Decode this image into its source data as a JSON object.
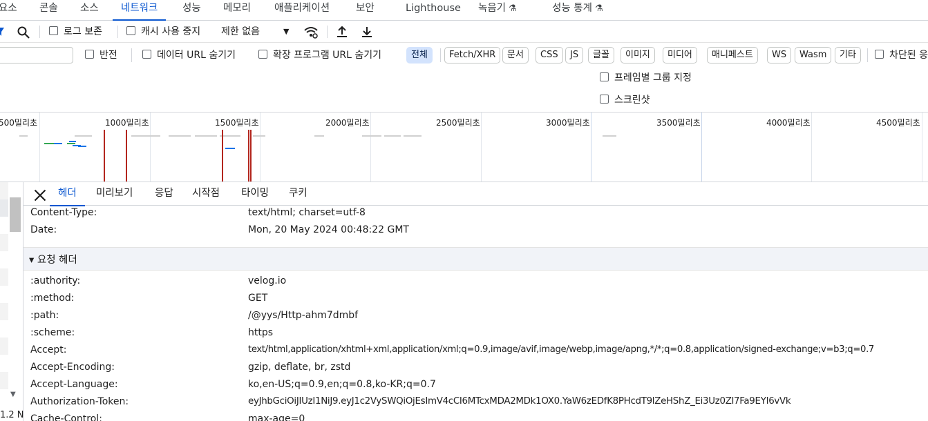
{
  "panel_tabs": [
    {
      "label": "요소"
    },
    {
      "label": "콘솔"
    },
    {
      "label": "소스"
    },
    {
      "label": "네트워크"
    },
    {
      "label": "성능"
    },
    {
      "label": "메모리"
    },
    {
      "label": "애플리케이션"
    },
    {
      "label": "보안"
    },
    {
      "label": "Lighthouse"
    },
    {
      "label": "녹음기"
    },
    {
      "label": "성능 통계"
    }
  ],
  "active_panel": "네트워크",
  "toolbar": {
    "preserve_log": "로그 보존",
    "disable_cache": "캐시 사용 중지",
    "throttling": "제한 없음"
  },
  "filters": {
    "invert": "반전",
    "hide_data_urls": "데이터 URL 숨기기",
    "hide_extension_urls": "확장 프로그램 URL 숨기기",
    "types": [
      "전체",
      "Fetch/XHR",
      "문서",
      "CSS",
      "JS",
      "글꼴",
      "이미지",
      "미디어",
      "매니페스트",
      "WS",
      "Wasm",
      "기타"
    ],
    "active_type": "전체",
    "blocked": "차단된 응"
  },
  "options": {
    "group_by_frame": "프레임별 그룹 지정",
    "screenshots": "스크린샷"
  },
  "timeline": {
    "ticks": [
      "500밀리초",
      "1000밀리초",
      "1500밀리초",
      "2000밀리초",
      "2500밀리초",
      "3000밀리초",
      "3500밀리초",
      "4000밀리초",
      "4500밀리초"
    ]
  },
  "left_pane": {
    "status": "1.2 N"
  },
  "detail_tabs": [
    {
      "label": "헤더"
    },
    {
      "label": "미리보기"
    },
    {
      "label": "응답"
    },
    {
      "label": "시작점"
    },
    {
      "label": "타이밍"
    },
    {
      "label": "쿠키"
    }
  ],
  "response_headers": [
    {
      "name": "Content-Type:",
      "value": "text/html; charset=utf-8"
    },
    {
      "name": "Date:",
      "value": "Mon, 20 May 2024 00:48:22 GMT"
    }
  ],
  "request_section_title": "▾ 요청 헤더",
  "request_headers": [
    {
      "name": ":authority:",
      "value": "velog.io"
    },
    {
      "name": ":method:",
      "value": "GET"
    },
    {
      "name": ":path:",
      "value": "/@yys/Http-ahm7dmbf"
    },
    {
      "name": ":scheme:",
      "value": "https"
    },
    {
      "name": "Accept:",
      "value": "text/html,application/xhtml+xml,application/xml;q=0.9,image/avif,image/webp,image/apng,*/*;q=0.8,application/signed-exchange;v=b3;q=0.7"
    },
    {
      "name": "Accept-Encoding:",
      "value": "gzip, deflate, br, zstd"
    },
    {
      "name": "Accept-Language:",
      "value": "ko,en-US;q=0.9,en;q=0.8,ko-KR;q=0.7"
    },
    {
      "name": "Authorization-Token:",
      "value": "eyJhbGciOiJIUzI1NiJ9.eyJ1c2VySWQiOjEsImV4cCI6MTcxMDA2MDk1OX0.YaW6zEDfK8PHcdT9lZeHShZ_Ei3Uz0Zl7Fa9EYI6vVk"
    },
    {
      "name": "Cache-Control:",
      "value": "max-age=0"
    }
  ],
  "colors": {
    "accent": "#0b57d0",
    "chip_active_bg": "#d3e3fd",
    "section_bg": "#f1f3f8",
    "marker_red": "#b3261e"
  }
}
